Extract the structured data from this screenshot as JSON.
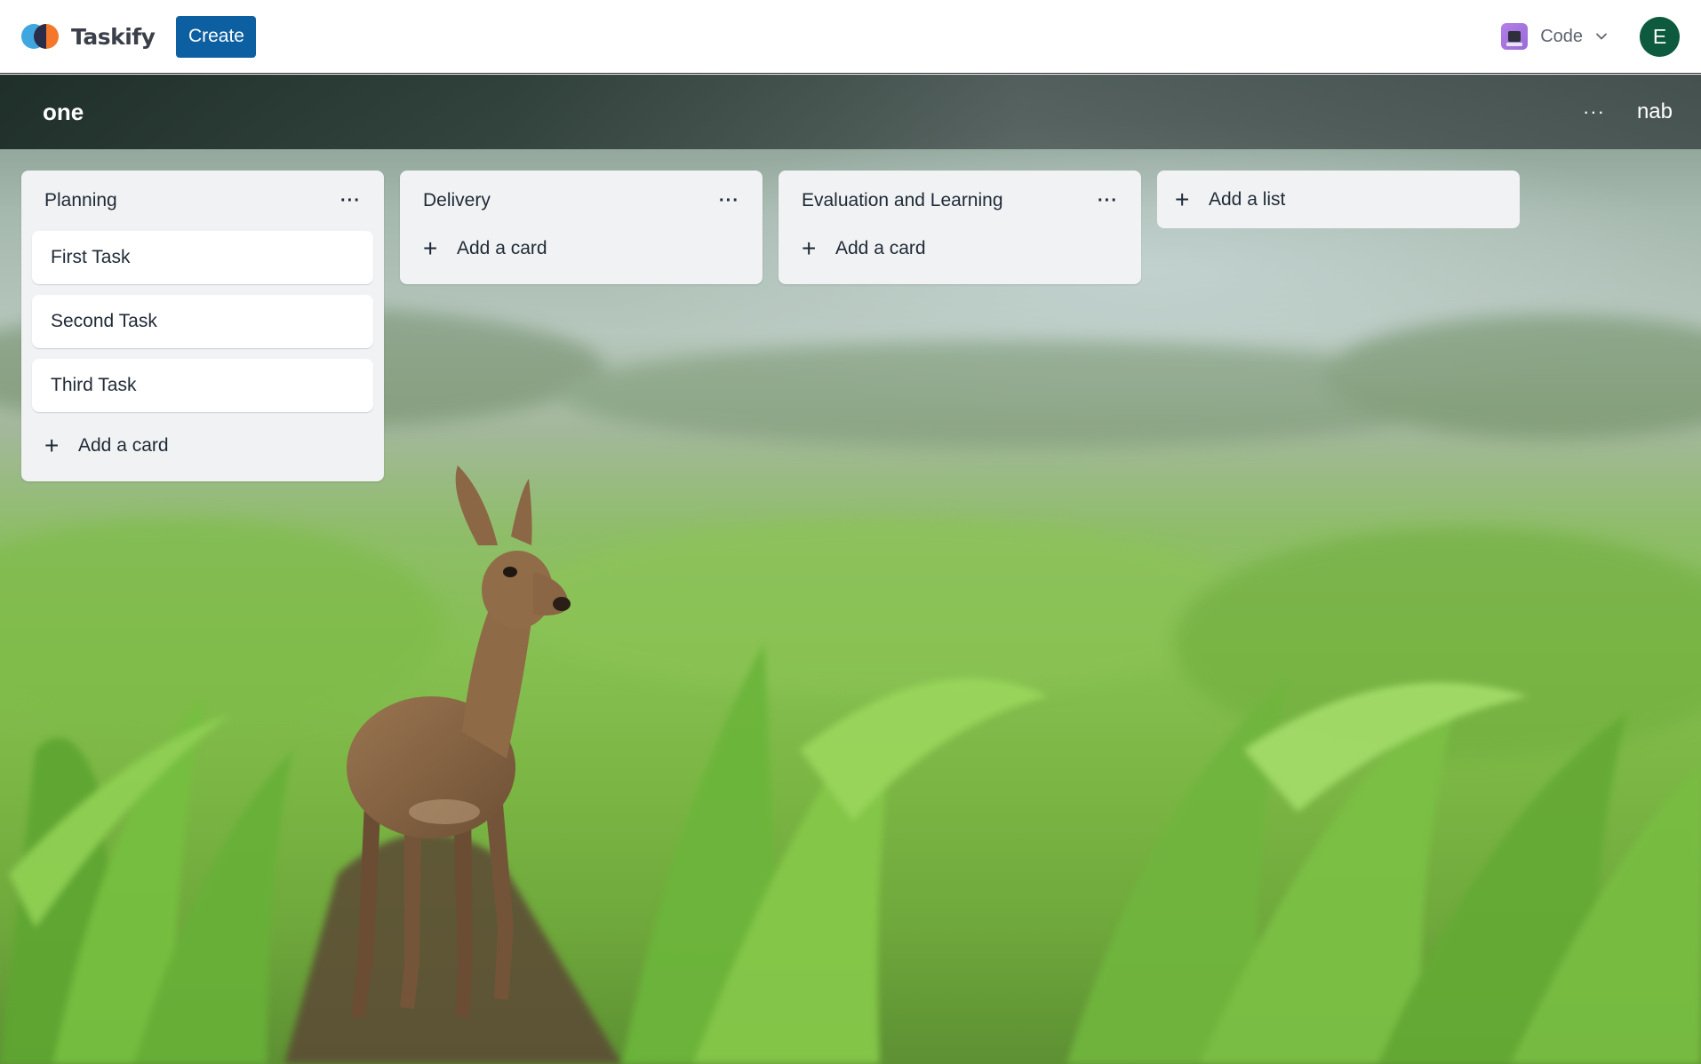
{
  "navbar": {
    "app_name": "Taskify",
    "create_label": "Create",
    "workspace_label": "Code",
    "avatar_initial": "E"
  },
  "board": {
    "title": "one",
    "menu_label": "···",
    "user_label": "nab"
  },
  "lists": [
    {
      "title": "Planning",
      "menu_label": "···",
      "cards": [
        "First Task",
        "Second Task",
        "Third Task"
      ],
      "add_card_label": "Add a card"
    },
    {
      "title": "Delivery",
      "menu_label": "···",
      "cards": [],
      "add_card_label": "Add a card"
    },
    {
      "title": "Evaluation and Learning",
      "menu_label": "···",
      "cards": [],
      "add_card_label": "Add a card"
    }
  ],
  "add_list_label": "Add a list",
  "icons": {
    "plus": "+",
    "chevron": "chevron-down-icon",
    "workspace": "computer-icon"
  },
  "colors": {
    "create_button": "#0c5fa0",
    "avatar": "#0d5a3e",
    "list_bg": "#f1f2f4"
  }
}
